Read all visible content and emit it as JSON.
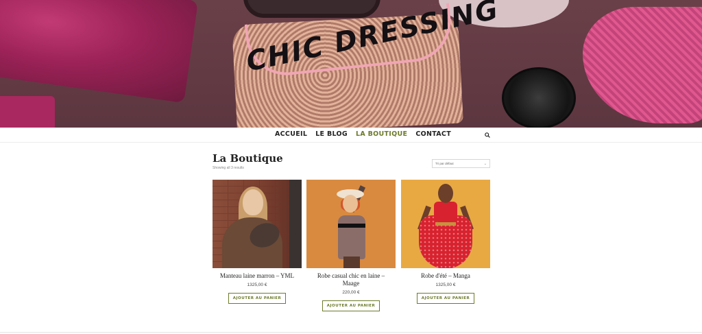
{
  "header": {
    "site_title": "CHIC DRESSING"
  },
  "nav": {
    "items": [
      {
        "label": "ACCUEIL",
        "active": false
      },
      {
        "label": "LE BLOG",
        "active": false
      },
      {
        "label": "LA BOUTIQUE",
        "active": true
      },
      {
        "label": "CONTACT",
        "active": false
      }
    ],
    "search_icon": "search-icon",
    "active_color": "#6d7a2a"
  },
  "shop": {
    "title": "La Boutique",
    "result_count": "Showing all 3 results",
    "orderby": {
      "selected": "Tri par défaut"
    },
    "products": [
      {
        "name": "Manteau laine marron – YML",
        "price": "1325,00 €",
        "button": "AJOUTER AU PANIER"
      },
      {
        "name": "Robe casual chic en laine – Maage",
        "price": "220,00 €",
        "button": "AJOUTER AU PANIER"
      },
      {
        "name": "Robe d'été – Manga",
        "price": "1325,00 €",
        "button": "AJOUTER AU PANIER"
      }
    ]
  }
}
